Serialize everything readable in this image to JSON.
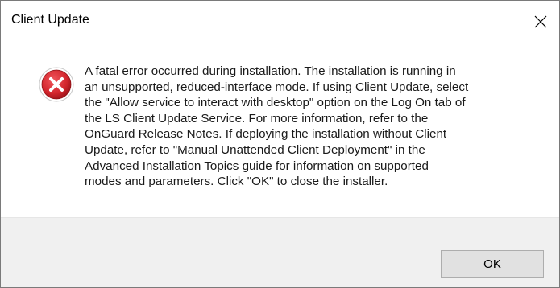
{
  "window": {
    "title": "Client Update",
    "close_icon": "close-icon"
  },
  "message": {
    "icon": "error-icon",
    "icon_color": "#d3262d",
    "text": "A fatal error occurred during installation. The installation is running in\nan unsupported, reduced-interface mode. If using Client Update, select\nthe \"Allow service to interact with desktop\" option on the Log On tab of\nthe LS Client Update Service. For more information, refer to the\nOnGuard Release Notes. If deploying the installation without Client\nUpdate, refer to \"Manual Unattended Client Deployment\" in the\nAdvanced Installation Topics guide for information on supported\nmodes and parameters. Click \"OK\" to close the installer."
  },
  "buttons": {
    "ok_label": "OK"
  }
}
